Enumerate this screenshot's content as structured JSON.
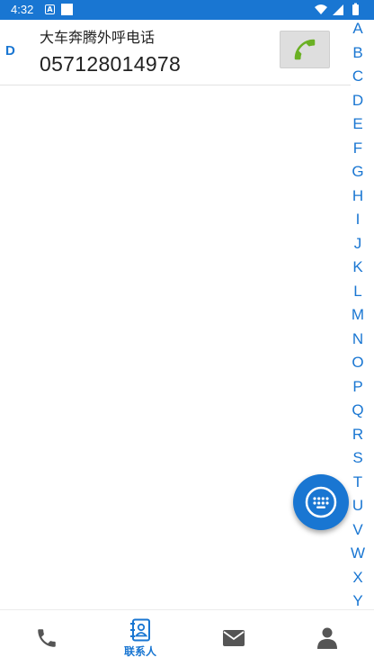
{
  "status_bar": {
    "time": "4:32",
    "a_badge": "A",
    "background": "#1976d2"
  },
  "contacts": [
    {
      "section": "D",
      "name": "大车奔腾外呼电话",
      "number": "057128014978"
    }
  ],
  "alphabet": [
    "A",
    "B",
    "C",
    "D",
    "E",
    "F",
    "G",
    "H",
    "I",
    "J",
    "K",
    "L",
    "M",
    "N",
    "O",
    "P",
    "Q",
    "R",
    "S",
    "T",
    "U",
    "V",
    "W",
    "X",
    "Y"
  ],
  "bottom_nav": {
    "items": [
      {
        "name": "phone",
        "icon": "phone-icon",
        "label": ""
      },
      {
        "name": "contacts",
        "icon": "contacts-book-icon",
        "label": "联系人",
        "active": true
      },
      {
        "name": "messages",
        "icon": "envelope-icon",
        "label": ""
      },
      {
        "name": "profile",
        "icon": "person-icon",
        "label": ""
      }
    ]
  },
  "colors": {
    "accent": "#1976d2",
    "call_green": "#6ab023",
    "nav_icon": "#555555"
  }
}
